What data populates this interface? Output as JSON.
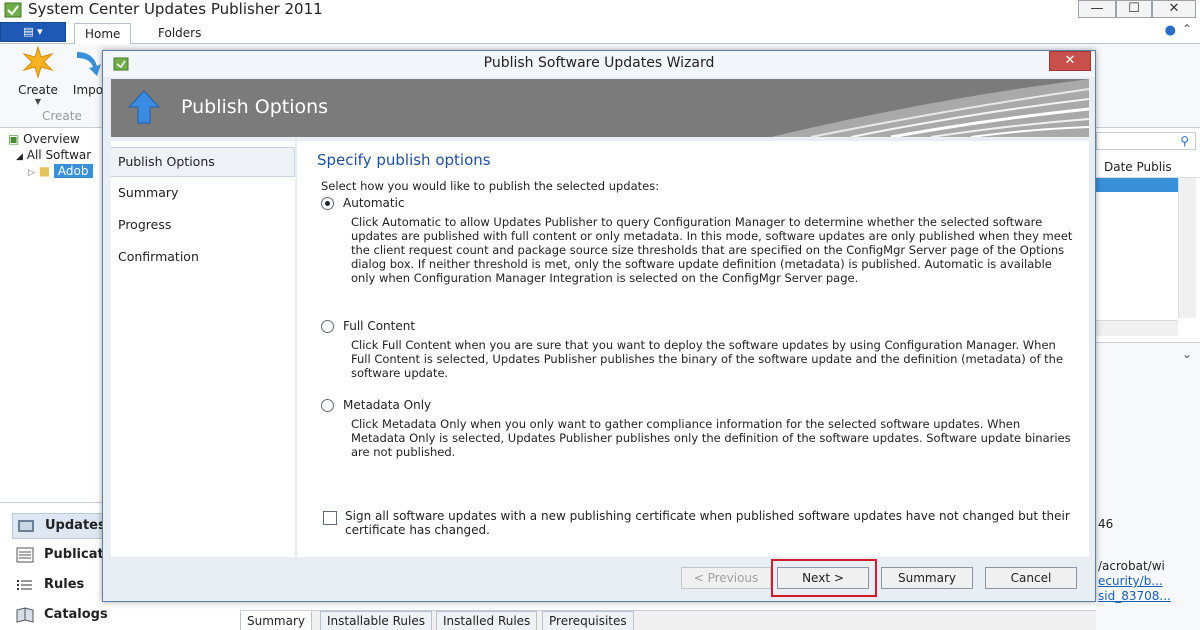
{
  "app": {
    "title": "System Center Updates Publisher 2011",
    "window_controls": {
      "minimize": "—",
      "maximize": "☐",
      "close": "✕"
    },
    "ribbon": {
      "file_menu_icon": "file-menu-icon",
      "tabs": [
        {
          "label": "Home"
        },
        {
          "label": "Folders"
        }
      ],
      "help_icon": "help-icon",
      "collapse_icon": "chevron-up-icon",
      "buttons": {
        "create": "Create",
        "import": "Impo"
      },
      "group_label": "Create"
    },
    "navigation": {
      "overview": "Overview",
      "all_software": "All Softwar",
      "adobe": "Adob"
    },
    "workspaces": [
      {
        "label": "Updates"
      },
      {
        "label": "Publicat"
      },
      {
        "label": "Rules"
      },
      {
        "label": "Catalogs"
      }
    ],
    "list": {
      "column_date": "Date Publis",
      "detail_number": "46",
      "detail_path": "/acrobat/wi",
      "detail_link_1": "ecurity/b...",
      "detail_link_2": "sid_83708..."
    },
    "bottom_tabs": [
      {
        "label": "Summary"
      },
      {
        "label": "Installable Rules"
      },
      {
        "label": "Installed Rules"
      },
      {
        "label": "Prerequisites"
      }
    ]
  },
  "wizard": {
    "title": "Publish Software Updates Wizard",
    "close_label": "✕",
    "header_title": "Publish Options",
    "steps": [
      {
        "label": "Publish Options"
      },
      {
        "label": "Summary"
      },
      {
        "label": "Progress"
      },
      {
        "label": "Confirmation"
      }
    ],
    "content": {
      "heading": "Specify publish options",
      "instruction": "Select how you would like to publish the selected updates:",
      "options": [
        {
          "label": "Automatic",
          "checked": true,
          "description": "Click Automatic to allow Updates Publisher to query Configuration Manager to determine whether the selected software updates are published with full content or only metadata. In this mode, software updates are only published when they meet the client request count and package source size thresholds that are specified on the ConfigMgr Server page of the Options dialog box. If neither threshold is met, only the software update definition (metadata) is published. Automatic is available only when Configuration Manager Integration is selected on the ConfigMgr Server page."
        },
        {
          "label": "Full Content",
          "checked": false,
          "description": "Click Full Content when you are sure that you want to deploy the software updates by using Configuration Manager. When Full Content is selected, Updates Publisher publishes the binary of the software update and the definition (metadata) of the software update."
        },
        {
          "label": "Metadata Only",
          "checked": false,
          "description": "Click Metadata Only when you only want to gather compliance information for the selected software updates. When Metadata Only is selected, Updates Publisher publishes only the definition of the software updates. Software update binaries are not published."
        }
      ],
      "sign_checkbox_label": "Sign all software updates with a new publishing certificate when published software updates have not changed but their certificate has changed.",
      "sign_checked": false
    },
    "buttons": {
      "previous": "< Previous",
      "next": "Next >",
      "summary": "Summary",
      "cancel": "Cancel"
    },
    "highlight_color": "#d11d2b"
  }
}
